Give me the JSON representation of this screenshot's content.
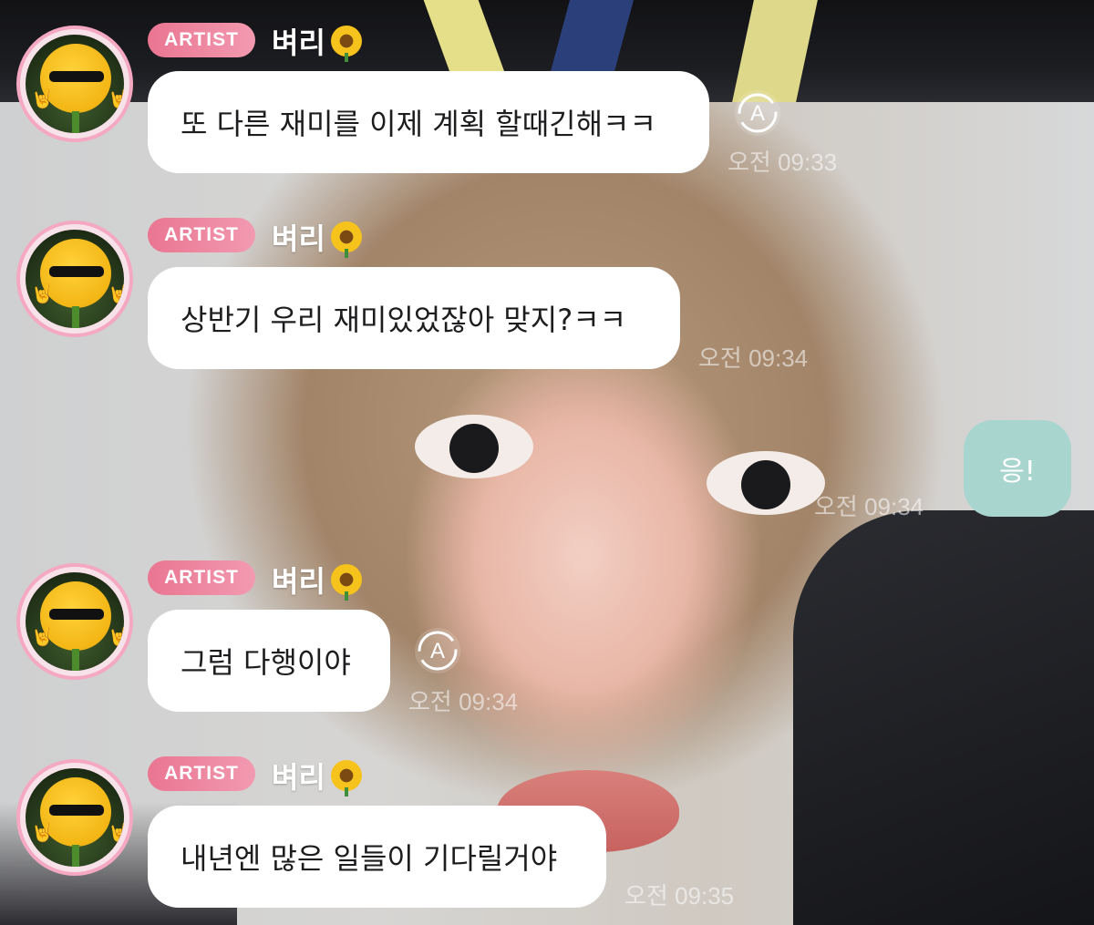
{
  "messages": [
    {
      "badge": "ARTIST",
      "name": "벼리",
      "text": "또 다른 재미를 이제 계획 할때긴해ㅋㅋ",
      "time": "오전 09:33",
      "has_translate": true
    },
    {
      "badge": "ARTIST",
      "name": "벼리",
      "text": "상반기 우리 재미있었잖아 맞지?ㅋㅋ",
      "time": "오전 09:34",
      "has_translate": false
    },
    {
      "badge": "ARTIST",
      "name": "벼리",
      "text": "그럼 다행이야",
      "time": "오전 09:34",
      "has_translate": true
    },
    {
      "badge": "ARTIST",
      "name": "벼리",
      "text": "내년엔 많은 일들이 기다릴거야",
      "time": "오전 09:35",
      "has_translate": false
    }
  ],
  "my_message": {
    "text": "응!",
    "time": "오전 09:34"
  },
  "icons": {
    "name_emoji": "sunflower-icon",
    "translate": "translate-icon",
    "avatar": "sunflower-sunglasses-avatar"
  },
  "colors": {
    "badge_start": "#ea7592",
    "badge_end": "#f29ab0",
    "avatar_ring": "#f4a8c2",
    "my_bubble": "#a9d5cf",
    "artist_bubble": "#ffffff"
  }
}
